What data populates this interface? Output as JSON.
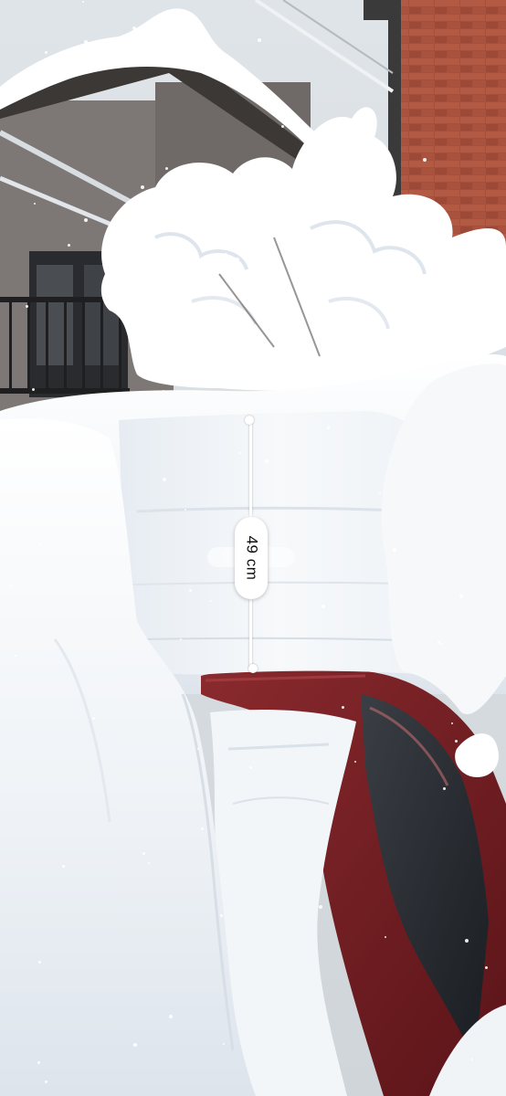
{
  "measurement": {
    "value": "49",
    "unit": "cm"
  },
  "colors": {
    "sky": "#dde2e6",
    "snow": "#ffffff",
    "brick": "#9a4a3a",
    "car": "#7a1f24",
    "house": "#7b7674",
    "overlay": "#ffffff"
  }
}
